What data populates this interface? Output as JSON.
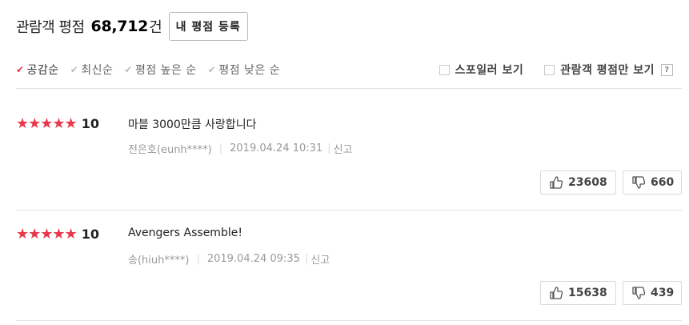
{
  "header": {
    "title": "관람객 평점",
    "count": "68,712",
    "unit": "건",
    "write_button": "내 평점 등록"
  },
  "sort": [
    {
      "label": "공감순",
      "active": true
    },
    {
      "label": "최신순",
      "active": false
    },
    {
      "label": "평점 높은 순",
      "active": false
    },
    {
      "label": "평점 낮은 순",
      "active": false
    }
  ],
  "options": {
    "spoiler": "스포일러 보기",
    "viewer_only": "관람객 평점만 보기",
    "help": "?"
  },
  "reviews": [
    {
      "stars": "★★★★★",
      "score": "10",
      "text": "마블 3000만큼 사랑합니다",
      "author": "전은호(eunh****)",
      "date": "2019.04.24 10:31",
      "report": "신고",
      "likes": "23608",
      "dislikes": "660"
    },
    {
      "stars": "★★★★★",
      "score": "10",
      "text": "Avengers Assemble!",
      "author": "송(hiuh****)",
      "date": "2019.04.24 09:35",
      "report": "신고",
      "likes": "15638",
      "dislikes": "439"
    }
  ],
  "colors": {
    "accent": "#e8374a",
    "divider": "#e2e2e2"
  }
}
